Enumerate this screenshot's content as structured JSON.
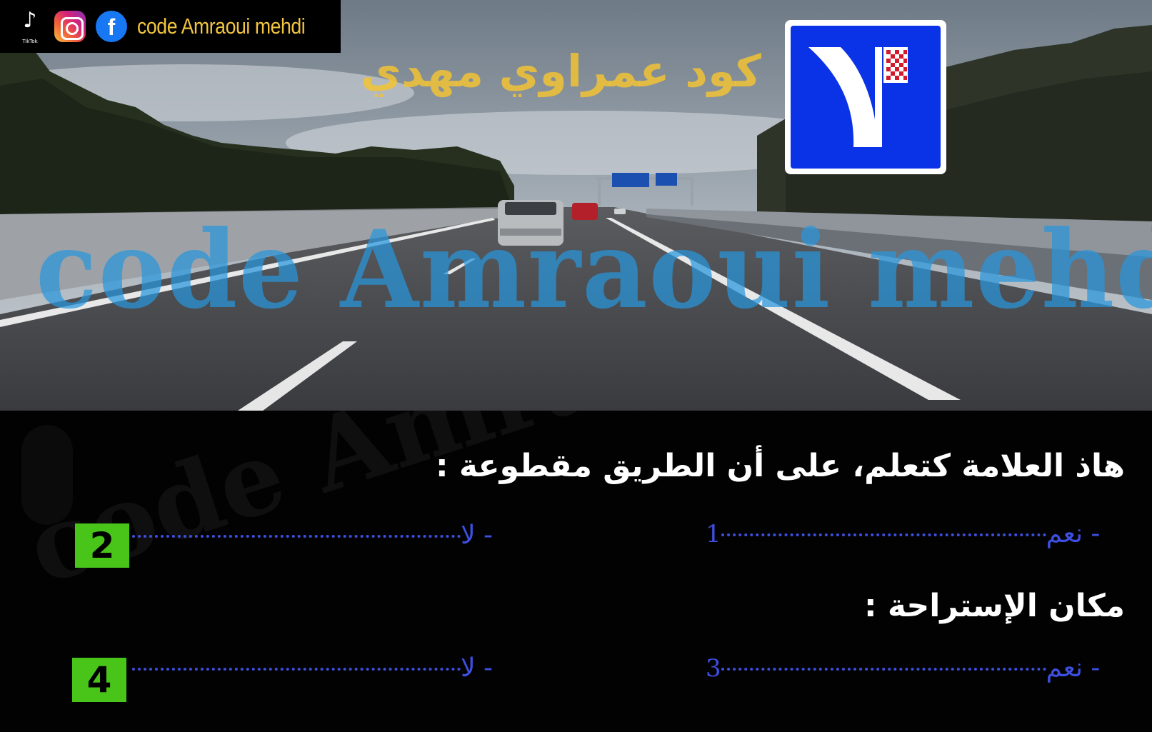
{
  "social": {
    "tiktok_icon": "tiktok-icon",
    "tiktok_label": "TikTok",
    "instagram_icon": "instagram-icon",
    "facebook_icon": "facebook-icon",
    "facebook_glyph": "f",
    "name": "code Amraoui mehdi"
  },
  "watermarks": {
    "arabic": "كود عمراوي مهدي",
    "latin": "code Amraoui mehdi"
  },
  "sign": {
    "icon": "lane-merge-road-sign",
    "colors": {
      "background": "#0a32e6",
      "border": "#ffffff",
      "block": "#d11a2a"
    }
  },
  "quiz": {
    "question_1": "هاذ العلامة كتعلم، على أن الطريق مقطوعة :",
    "question_2": "مكان الإستراحة :",
    "answers": [
      {
        "label": "- نعم",
        "number": "1"
      },
      {
        "label": "- لا",
        "number": "2"
      },
      {
        "label": "- نعم",
        "number": "3"
      },
      {
        "label": "- لا",
        "number": "4"
      }
    ],
    "colors": {
      "answer": "#3d4fe0",
      "badge": "#49c419"
    }
  }
}
